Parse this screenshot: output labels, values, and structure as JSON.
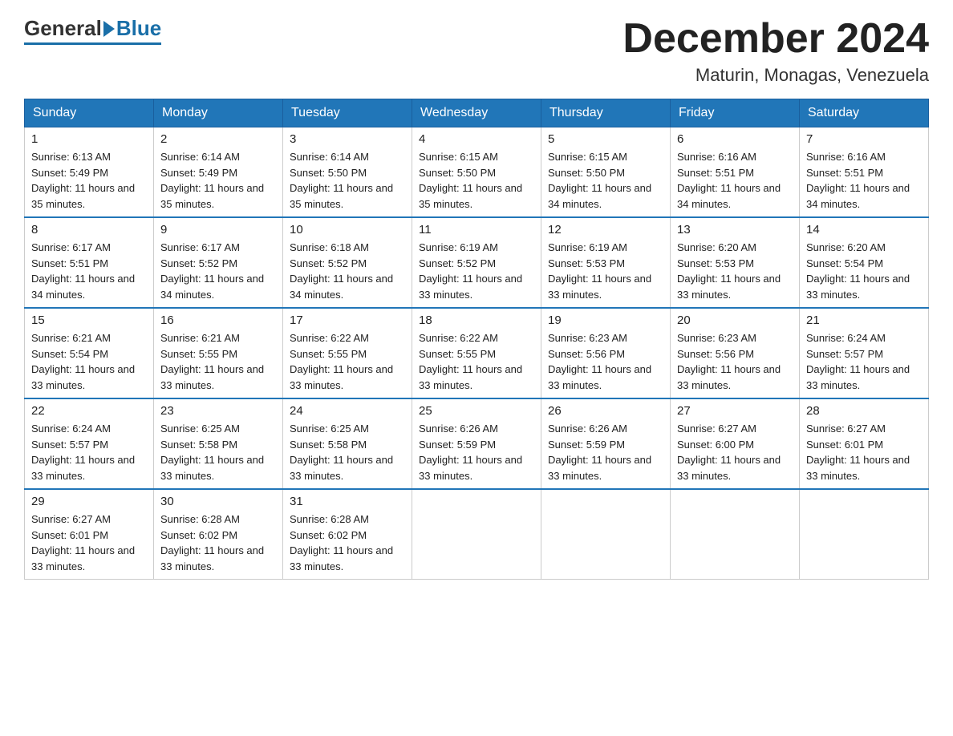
{
  "logo": {
    "general": "General",
    "blue": "Blue"
  },
  "title": "December 2024",
  "location": "Maturin, Monagas, Venezuela",
  "days_header": [
    "Sunday",
    "Monday",
    "Tuesday",
    "Wednesday",
    "Thursday",
    "Friday",
    "Saturday"
  ],
  "weeks": [
    [
      {
        "num": "1",
        "sunrise": "6:13 AM",
        "sunset": "5:49 PM",
        "daylight": "11 hours and 35 minutes."
      },
      {
        "num": "2",
        "sunrise": "6:14 AM",
        "sunset": "5:49 PM",
        "daylight": "11 hours and 35 minutes."
      },
      {
        "num": "3",
        "sunrise": "6:14 AM",
        "sunset": "5:50 PM",
        "daylight": "11 hours and 35 minutes."
      },
      {
        "num": "4",
        "sunrise": "6:15 AM",
        "sunset": "5:50 PM",
        "daylight": "11 hours and 35 minutes."
      },
      {
        "num": "5",
        "sunrise": "6:15 AM",
        "sunset": "5:50 PM",
        "daylight": "11 hours and 34 minutes."
      },
      {
        "num": "6",
        "sunrise": "6:16 AM",
        "sunset": "5:51 PM",
        "daylight": "11 hours and 34 minutes."
      },
      {
        "num": "7",
        "sunrise": "6:16 AM",
        "sunset": "5:51 PM",
        "daylight": "11 hours and 34 minutes."
      }
    ],
    [
      {
        "num": "8",
        "sunrise": "6:17 AM",
        "sunset": "5:51 PM",
        "daylight": "11 hours and 34 minutes."
      },
      {
        "num": "9",
        "sunrise": "6:17 AM",
        "sunset": "5:52 PM",
        "daylight": "11 hours and 34 minutes."
      },
      {
        "num": "10",
        "sunrise": "6:18 AM",
        "sunset": "5:52 PM",
        "daylight": "11 hours and 34 minutes."
      },
      {
        "num": "11",
        "sunrise": "6:19 AM",
        "sunset": "5:52 PM",
        "daylight": "11 hours and 33 minutes."
      },
      {
        "num": "12",
        "sunrise": "6:19 AM",
        "sunset": "5:53 PM",
        "daylight": "11 hours and 33 minutes."
      },
      {
        "num": "13",
        "sunrise": "6:20 AM",
        "sunset": "5:53 PM",
        "daylight": "11 hours and 33 minutes."
      },
      {
        "num": "14",
        "sunrise": "6:20 AM",
        "sunset": "5:54 PM",
        "daylight": "11 hours and 33 minutes."
      }
    ],
    [
      {
        "num": "15",
        "sunrise": "6:21 AM",
        "sunset": "5:54 PM",
        "daylight": "11 hours and 33 minutes."
      },
      {
        "num": "16",
        "sunrise": "6:21 AM",
        "sunset": "5:55 PM",
        "daylight": "11 hours and 33 minutes."
      },
      {
        "num": "17",
        "sunrise": "6:22 AM",
        "sunset": "5:55 PM",
        "daylight": "11 hours and 33 minutes."
      },
      {
        "num": "18",
        "sunrise": "6:22 AM",
        "sunset": "5:55 PM",
        "daylight": "11 hours and 33 minutes."
      },
      {
        "num": "19",
        "sunrise": "6:23 AM",
        "sunset": "5:56 PM",
        "daylight": "11 hours and 33 minutes."
      },
      {
        "num": "20",
        "sunrise": "6:23 AM",
        "sunset": "5:56 PM",
        "daylight": "11 hours and 33 minutes."
      },
      {
        "num": "21",
        "sunrise": "6:24 AM",
        "sunset": "5:57 PM",
        "daylight": "11 hours and 33 minutes."
      }
    ],
    [
      {
        "num": "22",
        "sunrise": "6:24 AM",
        "sunset": "5:57 PM",
        "daylight": "11 hours and 33 minutes."
      },
      {
        "num": "23",
        "sunrise": "6:25 AM",
        "sunset": "5:58 PM",
        "daylight": "11 hours and 33 minutes."
      },
      {
        "num": "24",
        "sunrise": "6:25 AM",
        "sunset": "5:58 PM",
        "daylight": "11 hours and 33 minutes."
      },
      {
        "num": "25",
        "sunrise": "6:26 AM",
        "sunset": "5:59 PM",
        "daylight": "11 hours and 33 minutes."
      },
      {
        "num": "26",
        "sunrise": "6:26 AM",
        "sunset": "5:59 PM",
        "daylight": "11 hours and 33 minutes."
      },
      {
        "num": "27",
        "sunrise": "6:27 AM",
        "sunset": "6:00 PM",
        "daylight": "11 hours and 33 minutes."
      },
      {
        "num": "28",
        "sunrise": "6:27 AM",
        "sunset": "6:01 PM",
        "daylight": "11 hours and 33 minutes."
      }
    ],
    [
      {
        "num": "29",
        "sunrise": "6:27 AM",
        "sunset": "6:01 PM",
        "daylight": "11 hours and 33 minutes."
      },
      {
        "num": "30",
        "sunrise": "6:28 AM",
        "sunset": "6:02 PM",
        "daylight": "11 hours and 33 minutes."
      },
      {
        "num": "31",
        "sunrise": "6:28 AM",
        "sunset": "6:02 PM",
        "daylight": "11 hours and 33 minutes."
      },
      null,
      null,
      null,
      null
    ]
  ]
}
